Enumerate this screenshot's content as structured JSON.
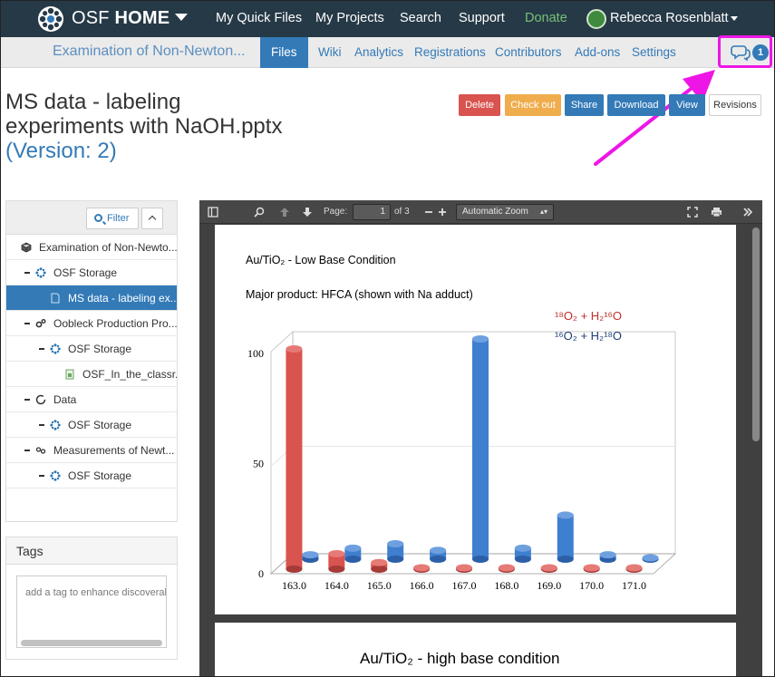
{
  "navbar": {
    "brand_light": "OSF",
    "brand_bold": "HOME",
    "links": [
      "My Quick Files",
      "My Projects",
      "Search",
      "Support",
      "Donate"
    ],
    "user": "Rebecca Rosenblatt"
  },
  "project_bar": {
    "title": "Examination of Non-Newton...",
    "tabs": [
      "Files",
      "Wiki",
      "Analytics",
      "Registrations",
      "Contributors",
      "Add-ons",
      "Settings"
    ],
    "active_tab": "Files",
    "comment_count": "1"
  },
  "file": {
    "title_line1": "MS data - labeling",
    "title_line2": "experiments with NaOH.pptx",
    "version": "(Version: 2)"
  },
  "actions": {
    "delete": "Delete",
    "checkout": "Check out",
    "share": "Share",
    "download": "Download",
    "view": "View",
    "revisions": "Revisions"
  },
  "tree": {
    "filter_label": "Filter",
    "rows": [
      "Examination of Non-Newto...",
      "OSF Storage",
      "MS data - labeling ex...",
      "Oobleck Production Pro...",
      "OSF Storage",
      "OSF_In_the_classr...",
      "Data",
      "OSF Storage",
      "Measurements of Newt...",
      "OSF Storage"
    ]
  },
  "tags": {
    "heading": "Tags",
    "placeholder": "add a tag to enhance discoverab"
  },
  "viewer": {
    "page_label": "Page:",
    "page_value": "1",
    "page_total": "of 3",
    "zoom": "Automatic Zoom"
  },
  "slide1": {
    "title": "Au/TiO₂ - Low Base Condition",
    "subtitle": "Major product: HFCA (shown with Na adduct)",
    "legend_red": "¹⁸O₂ + H₂¹⁶O",
    "legend_blue": "¹⁶O₂ + H₂¹⁸O"
  },
  "slide2": {
    "title": "Au/TiO₂ -  high base condition"
  },
  "chart_data": {
    "type": "bar",
    "categories": [
      "163.0",
      "164.0",
      "165.0",
      "166.0",
      "167.0",
      "168.0",
      "169.0",
      "170.0",
      "171.0"
    ],
    "ylim": [
      0,
      100
    ],
    "yticks": [
      "0",
      "50",
      "100"
    ],
    "series": [
      {
        "name": "¹⁸O₂ + H₂¹⁶O",
        "color": "#d9534f",
        "values": [
          100,
          7,
          3,
          0.5,
          0,
          0.5,
          0.5,
          0.5,
          0.5
        ]
      },
      {
        "name": "¹⁶O₂ + H₂¹⁸O",
        "color": "#3f7fd0",
        "values": [
          2,
          5,
          7,
          4,
          100,
          5,
          20,
          2,
          0
        ]
      }
    ]
  }
}
